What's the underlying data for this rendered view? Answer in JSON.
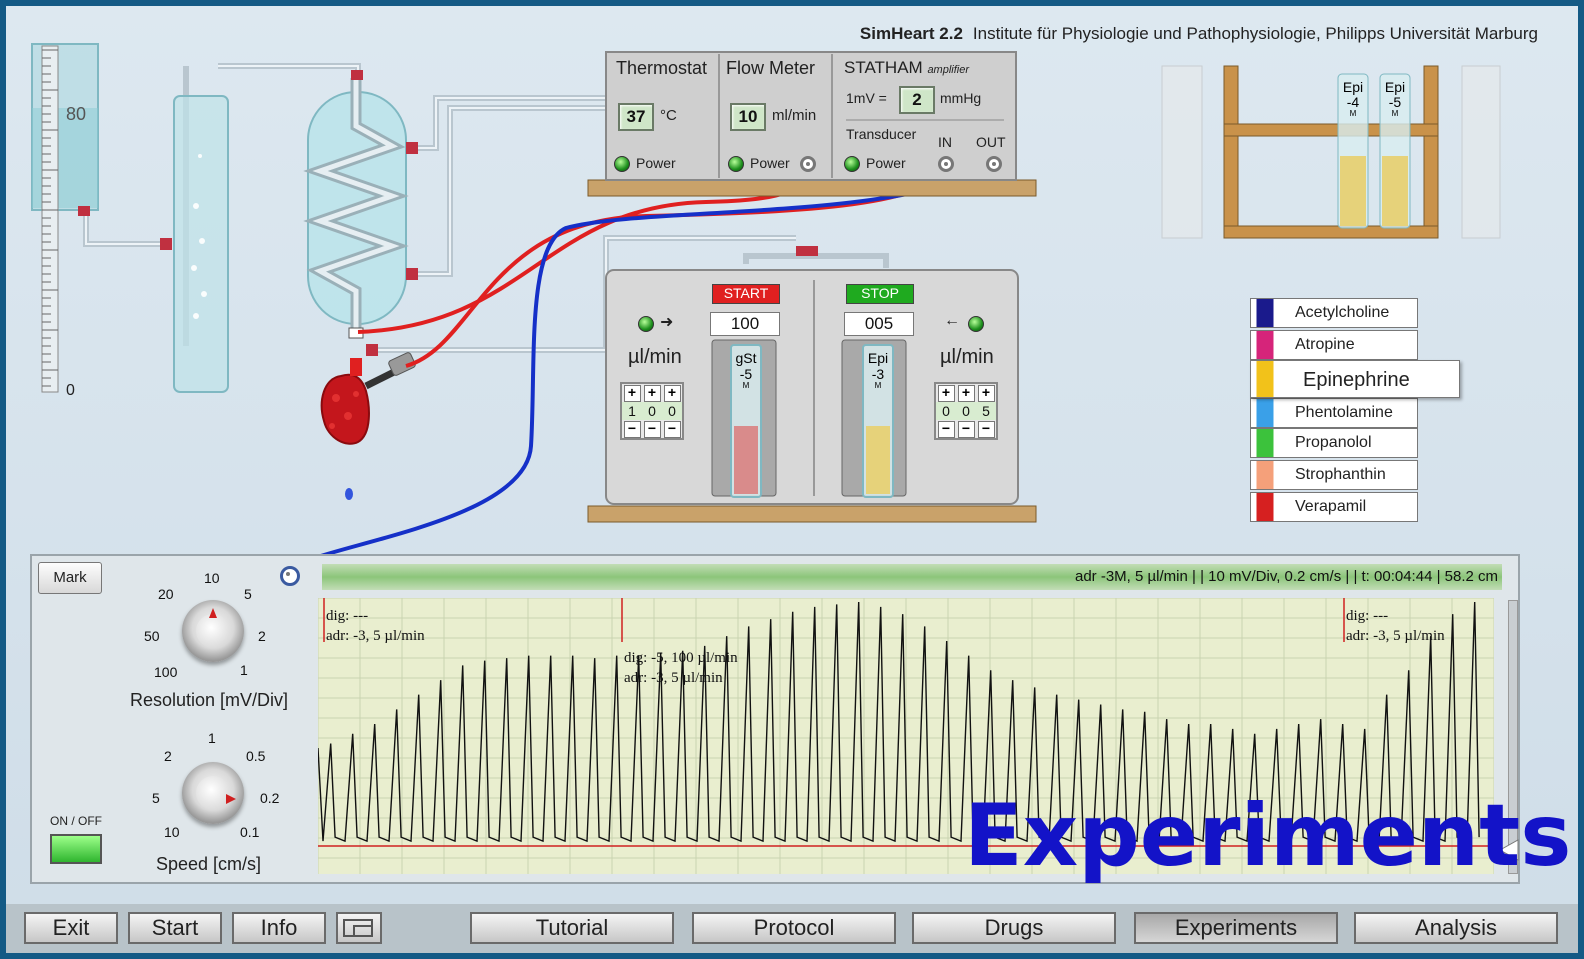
{
  "app": {
    "name": "SimHeart 2.2",
    "institute": "Institute für Physiologie und Pathophysiologie, Philipps Universität Marburg"
  },
  "burette": {
    "mark_top": "80",
    "mark_bottom": "0"
  },
  "thermostat": {
    "title": "Thermostat",
    "value": "37",
    "unit": "°C",
    "power": "Power"
  },
  "flow_meter": {
    "title": "Flow Meter",
    "value": "10",
    "unit": "ml/min",
    "power": "Power"
  },
  "amplifier": {
    "title": "STATHAM",
    "subtitle": "amplifier",
    "scale_prefix": "1mV =",
    "value": "2",
    "unit": "mmHg",
    "transducer": "Transducer",
    "in": "IN",
    "out": "OUT",
    "power": "Power"
  },
  "shelf_tubes": [
    {
      "label": "Epi",
      "conc": "-4",
      "unit": "M"
    },
    {
      "label": "Epi",
      "conc": "-5",
      "unit": "M"
    }
  ],
  "pump_left": {
    "button": "START",
    "button_color": "#e02020",
    "value": "100",
    "unit": "µl/min",
    "digits": [
      "1",
      "0",
      "0"
    ],
    "tube_label": "gSt",
    "tube_conc": "-5",
    "tube_unit": "M",
    "liquid_color": "#d98b8b"
  },
  "pump_right": {
    "button": "STOP",
    "button_color": "#1faa1f",
    "value": "005",
    "unit": "µl/min",
    "digits": [
      "0",
      "0",
      "5"
    ],
    "tube_label": "Epi",
    "tube_conc": "-3",
    "tube_unit": "M",
    "liquid_color": "#e6d27a"
  },
  "drugs": [
    {
      "name": "Acetylcholine",
      "color": "#1a1a8c",
      "selected": false
    },
    {
      "name": "Atropine",
      "color": "#d6247a",
      "selected": false
    },
    {
      "name": "Epinephrine",
      "color": "#f2c21a",
      "selected": true
    },
    {
      "name": "Phentolamine",
      "color": "#3aa0e8",
      "selected": false
    },
    {
      "name": "Propanolol",
      "color": "#3cc23c",
      "selected": false
    },
    {
      "name": "Strophanthin",
      "color": "#f5a07a",
      "selected": false
    },
    {
      "name": "Verapamil",
      "color": "#d62020",
      "selected": false
    }
  ],
  "recorder": {
    "mark_button": "Mark",
    "status": "adr -3M, 5 µl/min |  | 10 mV/Div, 0.2 cm/s |  | t: 00:04:44 | 58.2 cm",
    "resolution_label": "Resolution [mV/Div]",
    "resolution_ticks": [
      "10",
      "5",
      "2",
      "1",
      "100",
      "50",
      "20"
    ],
    "speed_label": "Speed [cm/s]",
    "speed_ticks": [
      "1",
      "0.5",
      "0.2",
      "0.1",
      "10",
      "5",
      "2"
    ],
    "onoff_label": "ON / OFF",
    "annotations": [
      {
        "line1": "dig: ---",
        "line2": "adr: -3, 5 µl/min"
      },
      {
        "line1": "dig: -5, 100 µl/min",
        "line2": "adr: -3, 5 µl/min"
      },
      {
        "line1": "dig: ---",
        "line2": "adr: -3, 5 µl/min"
      }
    ],
    "trace_envelope": [
      0.42,
      0.46,
      0.5,
      0.56,
      0.62,
      0.68,
      0.74,
      0.76,
      0.77,
      0.78,
      0.78,
      0.78,
      0.77,
      0.78,
      0.78,
      0.79,
      0.8,
      0.82,
      0.86,
      0.9,
      0.93,
      0.96,
      0.98,
      0.99,
      1.0,
      0.98,
      0.95,
      0.9,
      0.84,
      0.78,
      0.72,
      0.68,
      0.65,
      0.62,
      0.6,
      0.58,
      0.56,
      0.55,
      0.52,
      0.5,
      0.5,
      0.48,
      0.46,
      0.48,
      0.5,
      0.52,
      0.5,
      0.48,
      0.62,
      0.72,
      0.86,
      0.95,
      1.0
    ]
  },
  "overlay_word": "Experiments",
  "toolbar": [
    {
      "label": "Exit",
      "active": false
    },
    {
      "label": "Start",
      "active": false
    },
    {
      "label": "Info",
      "active": false
    },
    {
      "label": "Tutorial",
      "active": false
    },
    {
      "label": "Protocol",
      "active": false
    },
    {
      "label": "Drugs",
      "active": false
    },
    {
      "label": "Experiments",
      "active": true
    },
    {
      "label": "Analysis",
      "active": false
    }
  ]
}
